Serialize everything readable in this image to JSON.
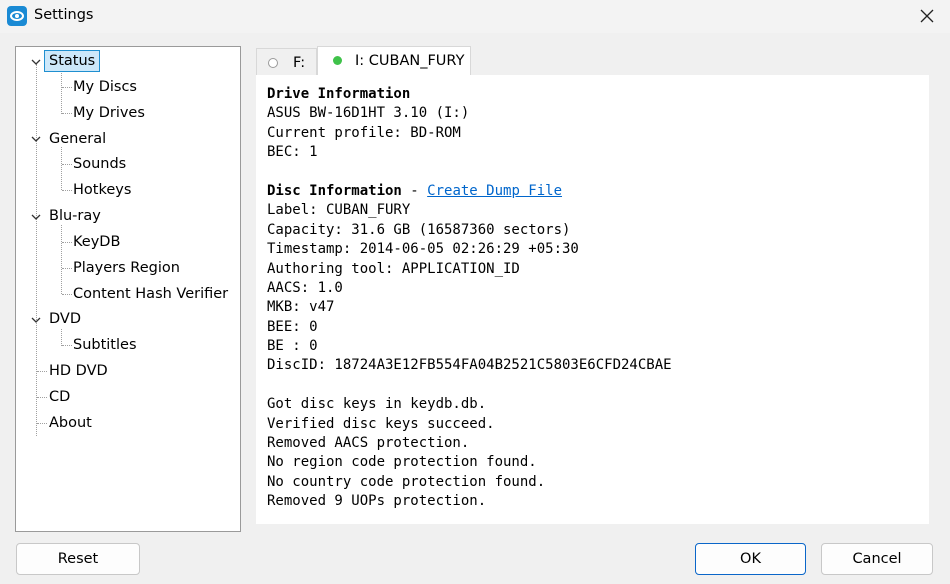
{
  "window": {
    "title": "Settings"
  },
  "tree": {
    "items": [
      {
        "label": "Status"
      },
      {
        "label": "My Discs"
      },
      {
        "label": "My Drives"
      },
      {
        "label": "General"
      },
      {
        "label": "Sounds"
      },
      {
        "label": "Hotkeys"
      },
      {
        "label": "Blu-ray"
      },
      {
        "label": "KeyDB"
      },
      {
        "label": "Players Region"
      },
      {
        "label": "Content Hash Verifier"
      },
      {
        "label": "DVD"
      },
      {
        "label": "Subtitles"
      },
      {
        "label": "HD DVD"
      },
      {
        "label": "CD"
      },
      {
        "label": "About"
      }
    ]
  },
  "tabs": [
    {
      "label": "F:"
    },
    {
      "label": "I: CUBAN_FURY"
    }
  ],
  "status": {
    "drive_heading": "Drive Information",
    "drive_lines": [
      "ASUS BW-16D1HT 3.10 (I:)",
      "Current profile: BD-ROM",
      "BEC: 1"
    ],
    "disc_heading": "Disc Information",
    "disc_sep": " - ",
    "dump_link": "Create Dump File",
    "disc_lines": [
      "Label: CUBAN_FURY",
      "Capacity: 31.6 GB (16587360 sectors)",
      "Timestamp: 2014-06-05 02:26:29 +05:30",
      "Authoring tool: APPLICATION_ID",
      "AACS: 1.0",
      "MKB: v47",
      "BEE: 0",
      "BE : 0",
      "DiscID: 18724A3E12FB554FA04B2521C5803E6CFD24CBAE"
    ],
    "log_lines": [
      "Got disc keys in keydb.db.",
      "Verified disc keys succeed.",
      "Removed AACS protection.",
      "No region code protection found.",
      "No country code protection found.",
      "Removed 9 UOPs protection."
    ]
  },
  "buttons": {
    "reset": "Reset",
    "ok": "OK",
    "cancel": "Cancel"
  },
  "colors": {
    "accent": "#0a66c9",
    "selection_bg": "#cde8fa",
    "link": "#0066cc",
    "status_dot": "#3fc24a"
  }
}
